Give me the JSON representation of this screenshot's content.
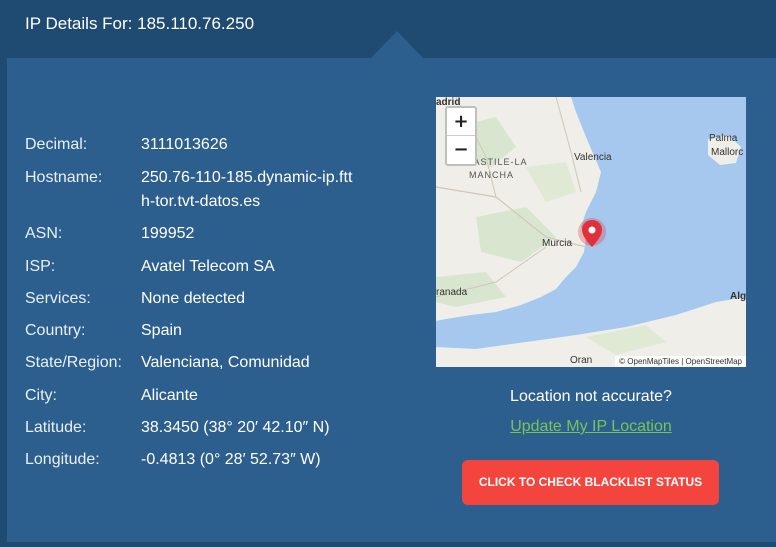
{
  "header": {
    "title": "IP Details For: 185.110.76.250"
  },
  "details": [
    {
      "label": "Decimal:",
      "value": "3111013626"
    },
    {
      "label": "Hostname:",
      "value": "250.76-110-185.dynamic-ip.ftth-tor.tvt-datos.es"
    },
    {
      "label": "ASN:",
      "value": "199952"
    },
    {
      "label": "ISP:",
      "value": "Avatel Telecom SA"
    },
    {
      "label": "Services:",
      "value": "None detected"
    },
    {
      "label": "Country:",
      "value": "Spain"
    },
    {
      "label": "State/Region:",
      "value": "Valenciana, Comunidad"
    },
    {
      "label": "City:",
      "value": "Alicante"
    },
    {
      "label": "Latitude:",
      "value": "38.3450 (38° 20′ 42.10″ N)"
    },
    {
      "label": "Longitude:",
      "value": "-0.4813 (0° 28′ 52.73″ W)"
    }
  ],
  "map": {
    "zoom_in": "+",
    "zoom_out": "−",
    "attribution": "© OpenMapTiles | OpenStreetMap",
    "labels": {
      "madrid": "adrid",
      "castile_1": "CASTILE-LA",
      "castile_2": "MANCHA",
      "valencia": "Valencia",
      "murcia": "Murcia",
      "granada": "ranada",
      "palma_1": "Palma",
      "palma_2": "Mallorc",
      "algiers": "Alg",
      "oran": "Oran"
    }
  },
  "location": {
    "question": "Location not accurate?",
    "update_link": "Update My IP Location"
  },
  "blacklist_button": "CLICK TO CHECK BLACKLIST STATUS",
  "colors": {
    "header_bg": "#1f4a72",
    "panel_bg": "#2d5f8e",
    "link": "#79c35a",
    "button": "#f3453d",
    "marker": "#e0313b",
    "sea": "#a6c8ee",
    "land": "#efeee8"
  }
}
